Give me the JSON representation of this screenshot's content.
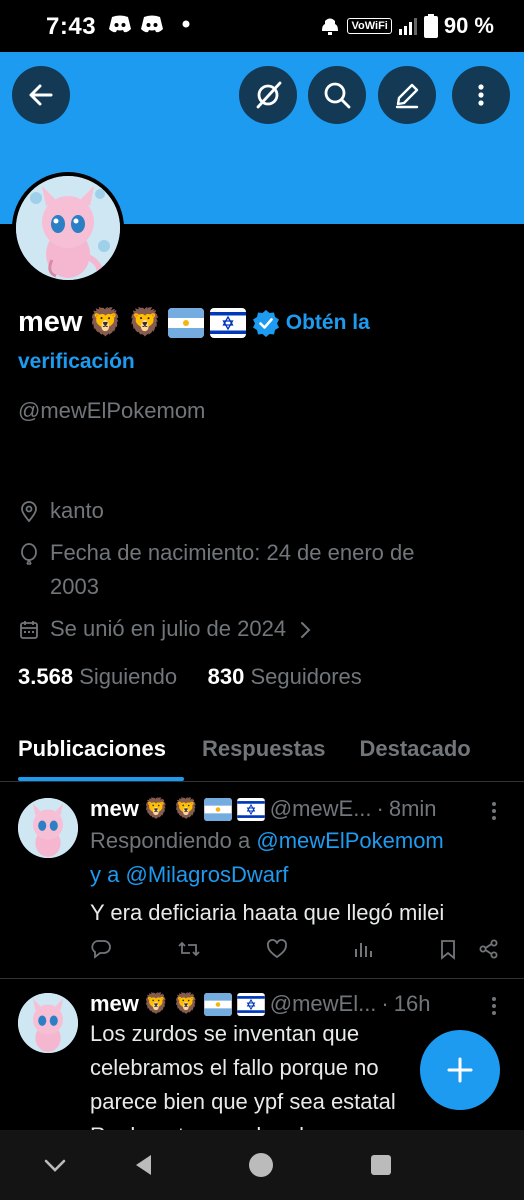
{
  "status_bar": {
    "time": "7:43",
    "network": "VoWiFi",
    "battery": "90 %"
  },
  "profile": {
    "name": "mew",
    "verify_line1": "Obtén la",
    "verify_line2": "verificación",
    "handle": "@mewElPokemom",
    "location": "kanto",
    "birth_line1": "Fecha de nacimiento: 24 de enero de",
    "birth_line2": "2003",
    "joined": "Se unió en julio de 2024",
    "following_count": "3.568",
    "following_label": "Siguiendo",
    "followers_count": "830",
    "followers_label": "Seguidores"
  },
  "tabs": [
    {
      "label": "Publicaciones",
      "active": true
    },
    {
      "label": "Respuestas",
      "active": false
    },
    {
      "label": "Destacado",
      "active": false
    }
  ],
  "tweets": [
    {
      "name": "mew",
      "handle": "@mewE...",
      "sep": "·",
      "time": "8min",
      "reply_prefix": "Respondiendo a",
      "reply_user1": "@mewElPokemom",
      "reply_and": "y a",
      "reply_user2": "@MilagrosDwarf",
      "text": "Y era deficiaria haata que llegó milei"
    },
    {
      "name": "mew",
      "handle": "@mewEl...",
      "sep": "·",
      "time": "16h",
      "line1": "Los zurdos se inventan que",
      "line2": "celebramos el fallo porque no",
      "line3": "parece bien que ypf sea estatal",
      "line4": "Realmente no saben leer"
    }
  ],
  "colors": {
    "accent": "#1d9bf0",
    "background": "#000000",
    "muted": "#71767b"
  },
  "icons": [
    "back-arrow-icon",
    "grok-icon",
    "search-icon",
    "edit-icon",
    "more-vertical-icon",
    "location-icon",
    "balloon-icon",
    "calendar-icon",
    "verified-badge-icon",
    "reply-icon",
    "retweet-icon",
    "like-icon",
    "views-icon",
    "bookmark-icon",
    "share-icon",
    "plus-icon"
  ]
}
